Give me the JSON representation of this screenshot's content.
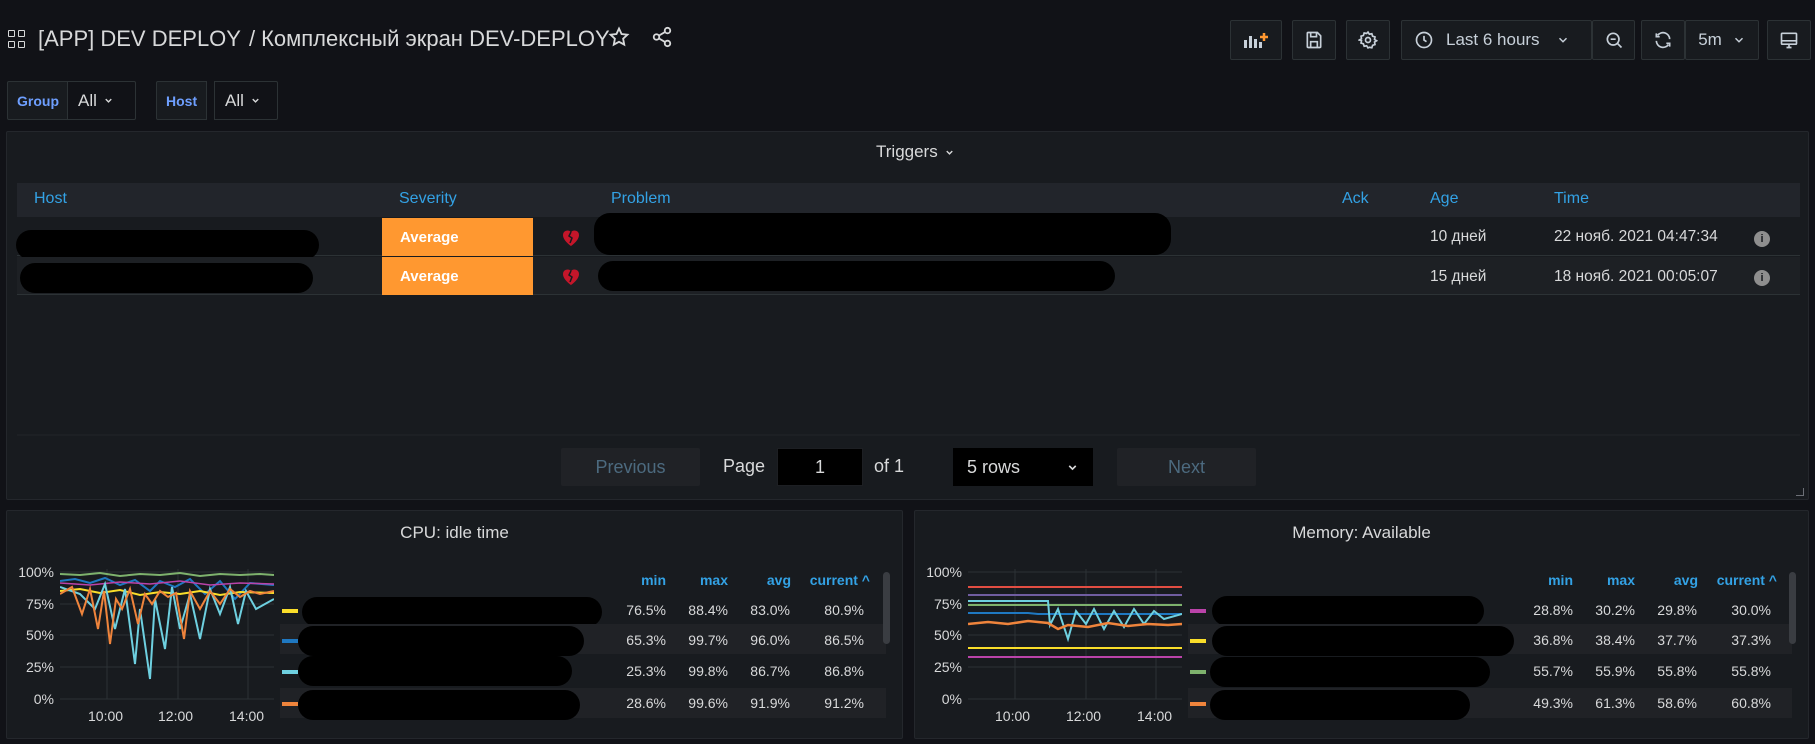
{
  "header": {
    "title": "[APP] DEV DEPLOY",
    "separator": "/",
    "subtitle": "Комплексный экран DEV-DEPLOY",
    "time_range": "Last 6 hours",
    "refresh_interval": "5m"
  },
  "variables": [
    {
      "label": "Group",
      "value": "All"
    },
    {
      "label": "Host",
      "value": "All"
    }
  ],
  "triggers": {
    "title": "Triggers",
    "columns": [
      "Host",
      "Severity",
      "Problem",
      "Ack",
      "Age",
      "Time"
    ],
    "rows": [
      {
        "severity": "Average",
        "age": "10 дней",
        "time": "22 нояб. 2021 04:47:34"
      },
      {
        "severity": "Average",
        "age": "15 дней",
        "time": "18 нояб. 2021 00:05:07"
      }
    ],
    "pagination": {
      "previous": "Previous",
      "page_label": "Page",
      "page": "1",
      "of_label": "of 1",
      "rows_option": "5 rows",
      "next": "Next"
    },
    "colors": {
      "severity_average": "#ff9830",
      "header_text": "#33a2e5"
    }
  },
  "cpu_panel": {
    "title": "CPU: idle time",
    "y_ticks": [
      "100%",
      "75%",
      "50%",
      "25%",
      "0%"
    ],
    "x_ticks": [
      "10:00",
      "12:00",
      "14:00"
    ],
    "legend_headers": {
      "min": "min",
      "max": "max",
      "avg": "avg",
      "current": "current ^"
    },
    "legend_rows": [
      {
        "color": "#fade2a",
        "min": "76.5%",
        "max": "88.4%",
        "avg": "83.0%",
        "current": "80.9%"
      },
      {
        "color": "#1f78c1",
        "min": "65.3%",
        "max": "99.7%",
        "avg": "96.0%",
        "current": "86.5%"
      },
      {
        "color": "#6ed0e0",
        "min": "25.3%",
        "max": "99.8%",
        "avg": "86.7%",
        "current": "86.8%"
      },
      {
        "color": "#ef843c",
        "min": "28.6%",
        "max": "99.6%",
        "avg": "91.9%",
        "current": "91.2%"
      }
    ]
  },
  "memory_panel": {
    "title": "Memory: Available",
    "y_ticks": [
      "100%",
      "75%",
      "50%",
      "25%",
      "0%"
    ],
    "x_ticks": [
      "10:00",
      "12:00",
      "14:00"
    ],
    "legend_headers": {
      "min": "min",
      "max": "max",
      "avg": "avg",
      "current": "current ^"
    },
    "legend_rows": [
      {
        "color": "#ba43a9",
        "min": "28.8%",
        "max": "30.2%",
        "avg": "29.8%",
        "current": "30.0%"
      },
      {
        "color": "#fade2a",
        "min": "36.8%",
        "max": "38.4%",
        "avg": "37.7%",
        "current": "37.3%"
      },
      {
        "color": "#7eb26d",
        "min": "55.7%",
        "max": "55.9%",
        "avg": "55.8%",
        "current": "55.8%"
      },
      {
        "color": "#ef843c",
        "min": "49.3%",
        "max": "61.3%",
        "avg": "58.6%",
        "current": "60.8%"
      }
    ]
  }
}
